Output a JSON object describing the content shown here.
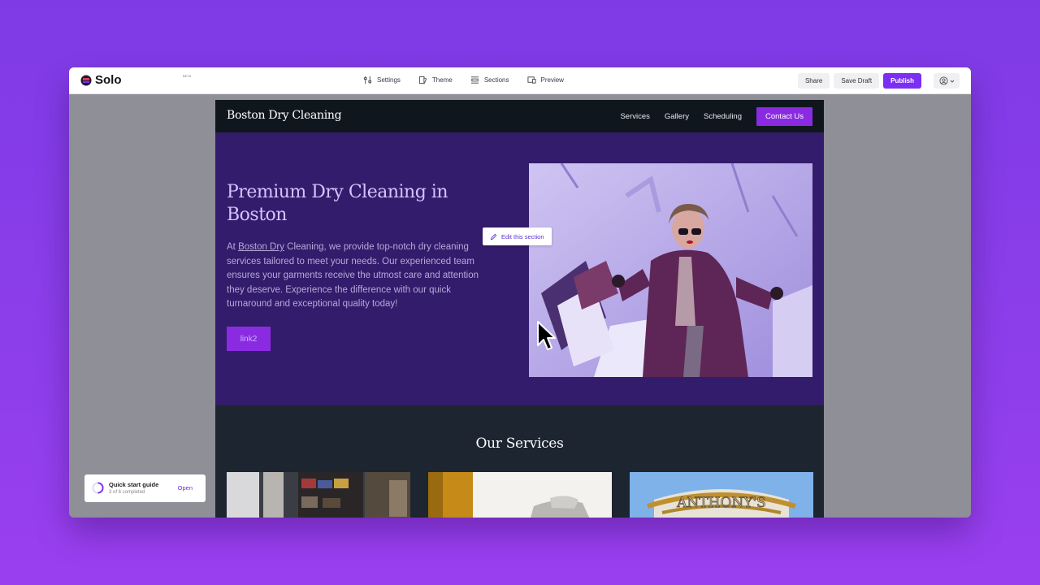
{
  "app": {
    "logo_text": "Solo",
    "logo_badge": "BETA",
    "nav": [
      {
        "label": "Settings",
        "icon": "sliders-icon"
      },
      {
        "label": "Theme",
        "icon": "theme-icon"
      },
      {
        "label": "Sections",
        "icon": "sections-icon"
      },
      {
        "label": "Preview",
        "icon": "preview-icon"
      }
    ],
    "share_label": "Share",
    "save_draft_label": "Save Draft",
    "publish_label": "Publish",
    "accent_color": "#7b2ff2"
  },
  "site": {
    "brand": "Boston Dry Cleaning",
    "nav": [
      "Services",
      "Gallery",
      "Scheduling"
    ],
    "contact_label": "Contact Us",
    "hero": {
      "title": "Premium Dry Cleaning in Boston",
      "text_prefix": "At ",
      "text_link": "Boston Dry",
      "text_body": " Cleaning, we provide top-notch dry cleaning services tailored to meet your needs. Our experienced team ensures your garments receive the utmost care and attention they deserve. Experience the difference with our quick turnaround and exceptional quality today!",
      "button_label": "link2"
    },
    "edit_section_label": "Edit this section",
    "services_title": "Our Services",
    "sign_text": "ANTHONY'S"
  },
  "quick_start": {
    "title": "Quick start guide",
    "progress_text": "3 of 6 completed",
    "progress": 0.5,
    "open_label": "Open"
  }
}
